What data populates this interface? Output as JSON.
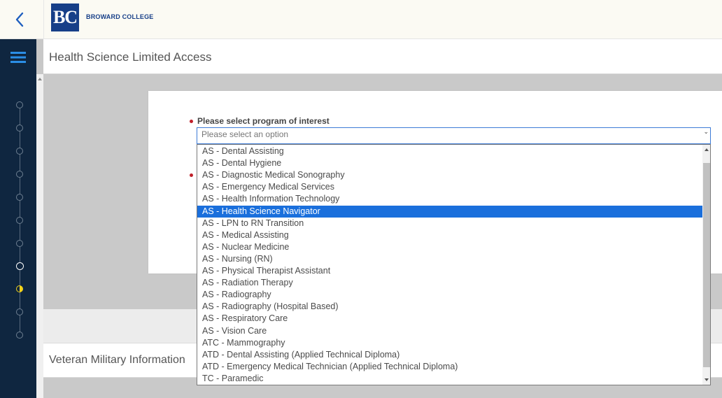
{
  "header": {
    "logo_initials": "BC",
    "college_name": "BROWARD COLLEGE",
    "back_icon": "chevron-left-icon"
  },
  "nav": {
    "menu_icon": "hamburger-icon",
    "step_count": 11,
    "current_step_index": 7,
    "active_step_index": 8
  },
  "page": {
    "title": "Health Science Limited Access"
  },
  "form": {
    "program_label": "Please select program of interest",
    "program_placeholder": "Please select an option"
  },
  "dropdown": {
    "selected_index": 5,
    "options": [
      "AS - Dental Assisting",
      "AS - Dental Hygiene",
      "AS - Diagnostic Medical Sonography",
      "AS - Emergency Medical Services",
      "AS - Health Information Technology",
      "AS - Health Science Navigator",
      "AS - LPN to RN Transition",
      "AS - Medical Assisting",
      "AS - Nuclear Medicine",
      "AS - Nursing (RN)",
      "AS - Physical Therapist Assistant",
      "AS - Radiation Therapy",
      "AS - Radiography",
      "AS - Radiography (Hospital Based)",
      "AS - Respiratory Care",
      "AS - Vision Care",
      "ATC - Mammography",
      "ATD - Dental Assisting (Applied Technical Diploma)",
      "ATD - Emergency Medical Technician (Applied Technical Diploma)",
      "TC - Paramedic"
    ]
  },
  "sections": {
    "veteran_title": "Veteran Military Information"
  },
  "colors": {
    "brand_blue": "#173f88",
    "nav_dark": "#0f2640",
    "selected_blue": "#1a6fdc",
    "required_red": "#c0202a",
    "active_step_yellow": "#f2d21b"
  }
}
